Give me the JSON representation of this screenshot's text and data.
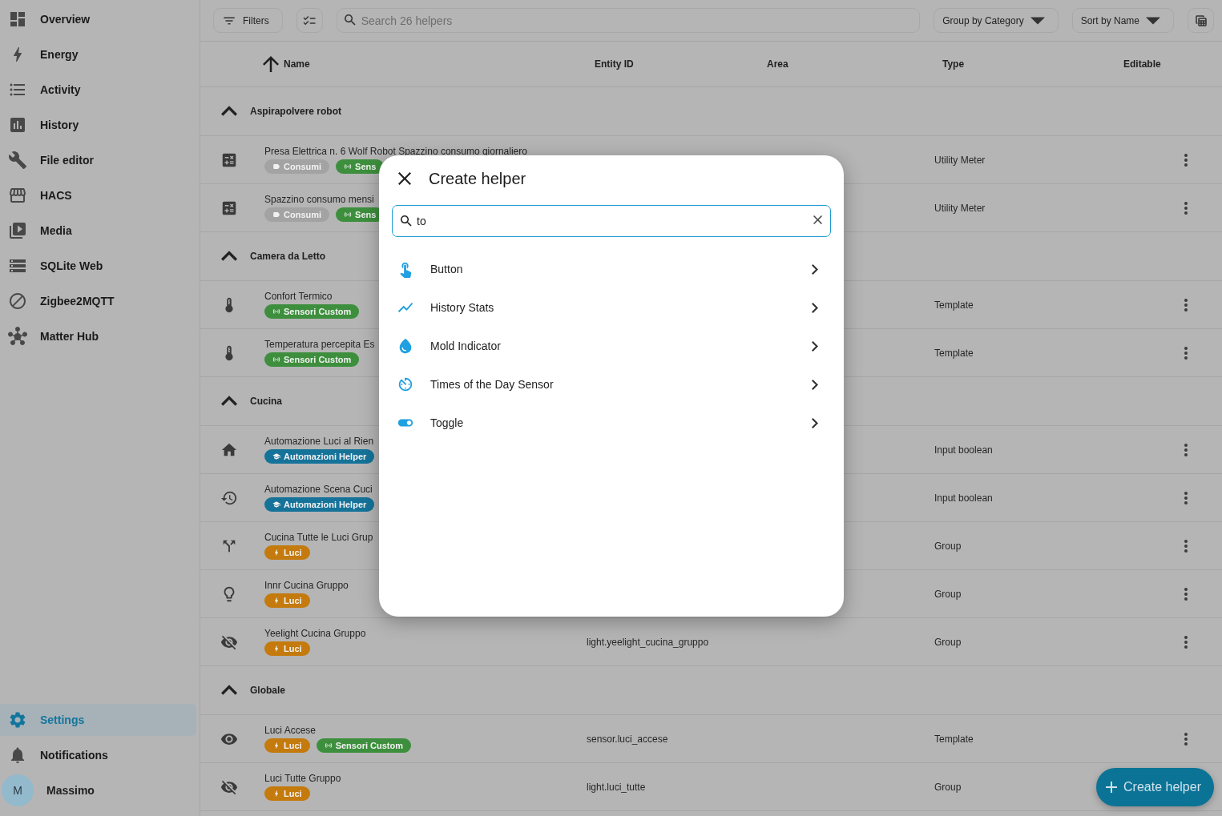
{
  "sidebar": {
    "items": [
      {
        "label": "Overview",
        "selected": false
      },
      {
        "label": "Energy",
        "selected": false
      },
      {
        "label": "Activity",
        "selected": false
      },
      {
        "label": "History",
        "selected": false
      },
      {
        "label": "File editor",
        "selected": false
      },
      {
        "label": "HACS",
        "selected": false
      },
      {
        "label": "Media",
        "selected": false
      },
      {
        "label": "SQLite Web",
        "selected": false
      },
      {
        "label": "Zigbee2MQTT",
        "selected": false
      },
      {
        "label": "Matter Hub",
        "selected": false
      }
    ],
    "bottom_items": [
      {
        "label": "Settings",
        "selected": true
      },
      {
        "label": "Notifications",
        "selected": false
      }
    ],
    "user": {
      "initial": "M",
      "name": "Massimo"
    }
  },
  "toolbar": {
    "filters": "Filters",
    "search": {
      "placeholder": "Search 26 helpers"
    },
    "group_by": "Group by Category",
    "sort_by": "Sort by Name"
  },
  "table": {
    "columns": [
      "Name",
      "Entity ID",
      "Area",
      "Type",
      "Editable"
    ],
    "groups": [
      {
        "name": "Aspirapolvere robot",
        "expanded": true,
        "rows": [
          {
            "name": "Presa Elettrica n. 6 Wolf Robot Spazzino consumo giornaliero",
            "chips": [
              {
                "label": "Consumi",
                "color": "#a3a3a3"
              },
              {
                "label": "Sens",
                "color": "#3d8f3d"
              }
            ],
            "type": "Utility Meter"
          },
          {
            "name": "Spazzino consumo mensi",
            "chips": [
              {
                "label": "Consumi",
                "color": "#a3a3a3"
              },
              {
                "label": "Sens",
                "color": "#3d8f3d"
              }
            ],
            "type": "Utility Meter"
          }
        ]
      },
      {
        "name": "Camera da Letto",
        "expanded": true,
        "rows": [
          {
            "name": "Confort Termico",
            "chips": [
              {
                "label": "Sensori Custom",
                "color": "#3d8f3d"
              }
            ],
            "type": "Template"
          },
          {
            "name": "Temperatura percepita Es",
            "chips": [
              {
                "label": "Sensori Custom",
                "color": "#3d8f3d"
              }
            ],
            "type": "Template"
          }
        ]
      },
      {
        "name": "Cucina",
        "expanded": true,
        "rows": [
          {
            "name": "Automazione Luci al Rien",
            "chips": [
              {
                "label": "Automazioni Helper",
                "color": "#15739a"
              }
            ],
            "type": "Input boolean"
          },
          {
            "name": "Automazione Scena Cuci",
            "chips": [
              {
                "label": "Automazioni Helper",
                "color": "#15739a"
              }
            ],
            "type": "Input boolean"
          },
          {
            "name": "Cucina Tutte le Luci Grup",
            "chips": [
              {
                "label": "Luci",
                "color": "#c47a0c"
              }
            ],
            "type": "Group"
          },
          {
            "name": "Innr Cucina Gruppo",
            "chips": [
              {
                "label": "Luci",
                "color": "#c47a0c"
              }
            ],
            "type": "Group"
          },
          {
            "name": "Yeelight Cucina Gruppo",
            "chips": [
              {
                "label": "Luci",
                "color": "#c47a0c"
              }
            ],
            "entity_id": "light.yeelight_cucina_gruppo",
            "type": "Group"
          }
        ]
      },
      {
        "name": "Globale",
        "expanded": true,
        "rows": [
          {
            "name": "Luci Accese",
            "chips": [
              {
                "label": "Luci",
                "color": "#c47a0c"
              },
              {
                "label": "Sensori Custom",
                "color": "#3d8f3d"
              }
            ],
            "entity_id": "sensor.luci_accese",
            "type": "Template"
          },
          {
            "name": "Luci Tutte Gruppo",
            "chips": [
              {
                "label": "Luci",
                "color": "#c47a0c"
              }
            ],
            "entity_id": "light.luci_tutte",
            "type": "Group"
          }
        ]
      }
    ]
  },
  "dialog": {
    "title": "Create helper",
    "search": {
      "value": "to"
    },
    "items": [
      {
        "label": "Button"
      },
      {
        "label": "History Stats"
      },
      {
        "label": "Mold Indicator"
      },
      {
        "label": "Times of the Day Sensor"
      },
      {
        "label": "Toggle"
      }
    ]
  },
  "fab": {
    "label": "Create helper"
  }
}
